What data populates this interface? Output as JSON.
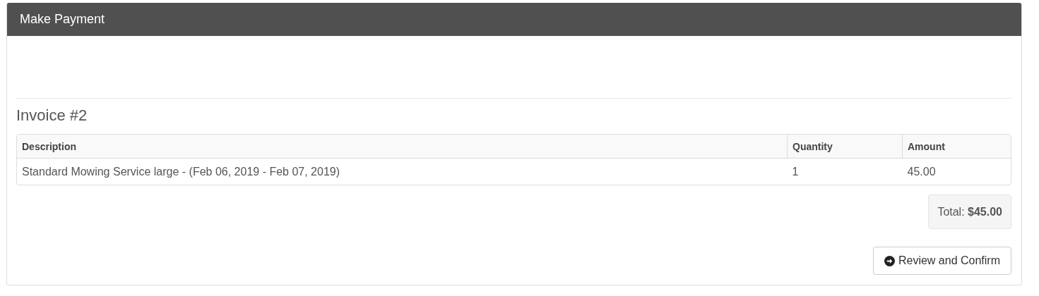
{
  "panel": {
    "title": "Make Payment"
  },
  "invoice": {
    "title": "Invoice #2",
    "columns": [
      "Description",
      "Quantity",
      "Amount"
    ],
    "rows": [
      [
        "Standard Mowing Service large - (Feb 06, 2019 - Feb 07, 2019)",
        "1",
        "45.00"
      ]
    ],
    "total": "Total: **$45.00**"
  },
  "buttons": [
    {
      "label": "Review and Confirm",
      "kind": "forward"
    }
  ]
}
